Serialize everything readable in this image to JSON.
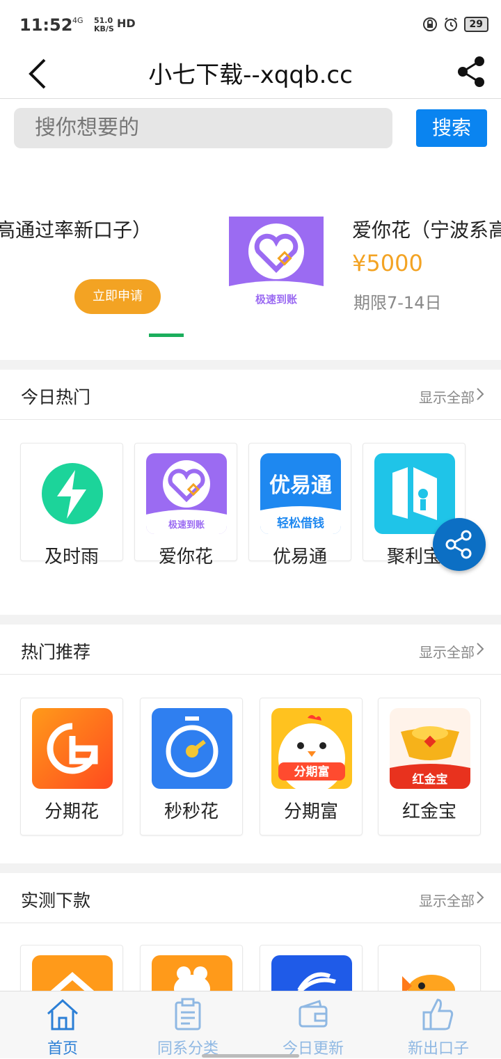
{
  "status": {
    "time": "11:52",
    "network": "4G",
    "speed": "51.0",
    "speed_unit": "KB/S",
    "hd": "HD",
    "battery": "29"
  },
  "header": {
    "title": "小七下载--xqqb.cc"
  },
  "search": {
    "placeholder": "搜你想要的",
    "button": "搜索"
  },
  "banner": {
    "left_title": "高通过率新口子）",
    "apply_label": "立即申请",
    "image_caption": "极速到账",
    "right_title": "爱你花（宁波系高",
    "price": "¥5000",
    "term": "期限7-14日"
  },
  "sections": [
    {
      "title": "今日热门",
      "more": "显示全部",
      "items": [
        {
          "label": "及时雨"
        },
        {
          "label": "爱你花",
          "caption": "极速到账"
        },
        {
          "label": "优易通",
          "logo_text": "优易通",
          "caption": "轻松借钱"
        },
        {
          "label": "聚利宝"
        }
      ]
    },
    {
      "title": "热门推荐",
      "more": "显示全部",
      "items": [
        {
          "label": "分期花"
        },
        {
          "label": "秒秒花"
        },
        {
          "label": "分期富",
          "caption": "分期富"
        },
        {
          "label": "红金宝",
          "caption": "红金宝"
        }
      ]
    },
    {
      "title": "实测下款",
      "more": "显示全部"
    }
  ],
  "tabs": [
    {
      "label": "首页"
    },
    {
      "label": "同系分类"
    },
    {
      "label": "今日更新"
    },
    {
      "label": "新出口子"
    }
  ],
  "colors": {
    "accent": "#0a84f0",
    "active_tab": "#2b7fd6",
    "inactive_tab": "#8fb8e3",
    "price": "#f3a323"
  }
}
